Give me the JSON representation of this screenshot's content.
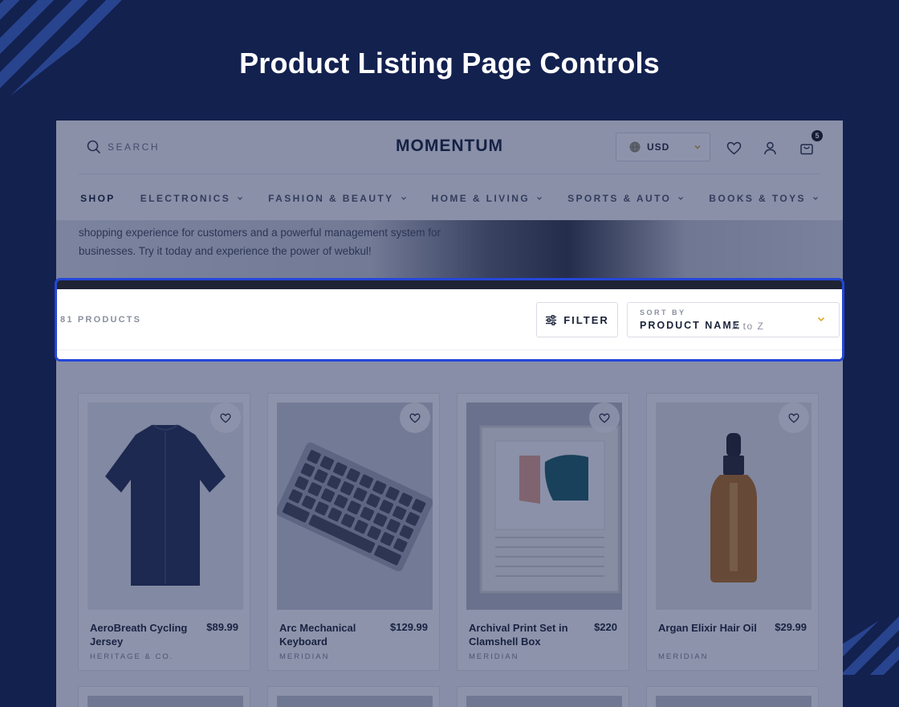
{
  "page": {
    "title": "Product Listing Page Controls"
  },
  "header": {
    "search_placeholder": "SEARCH",
    "logo": "MOMENTUM",
    "currency": "USD",
    "cart_count": "5"
  },
  "nav": {
    "items": [
      {
        "label": "SHOP",
        "has_dropdown": false
      },
      {
        "label": "ELECTRONICS",
        "has_dropdown": true
      },
      {
        "label": "FASHION & BEAUTY",
        "has_dropdown": true
      },
      {
        "label": "HOME & LIVING",
        "has_dropdown": true
      },
      {
        "label": "SPORTS & AUTO",
        "has_dropdown": true
      },
      {
        "label": "BOOKS & TOYS",
        "has_dropdown": true
      }
    ]
  },
  "banner": {
    "text": "shopping experience for customers and a powerful management system for businesses. Try it today and experience the power of webkul!"
  },
  "toolbar": {
    "product_count": "81 PRODUCTS",
    "filter_label": "FILTER",
    "sort_label": "SORT BY",
    "sort_value": "PRODUCT NAME",
    "sort_order": "A to Z"
  },
  "products": [
    {
      "name": "AeroBreath Cycling Jersey",
      "price": "$89.99",
      "brand": "HERITAGE & CO."
    },
    {
      "name": "Arc Mechanical Keyboard",
      "price": "$129.99",
      "brand": "MERIDIAN"
    },
    {
      "name": "Archival Print Set in Clamshell Box",
      "price": "$220",
      "brand": "MERIDIAN"
    },
    {
      "name": "Argan Elixir Hair Oil",
      "price": "$29.99",
      "brand": "MERIDIAN"
    }
  ],
  "colors": {
    "background": "#13214f",
    "highlight_border": "#2447d8",
    "accent_chevron": "#e0a92b"
  }
}
